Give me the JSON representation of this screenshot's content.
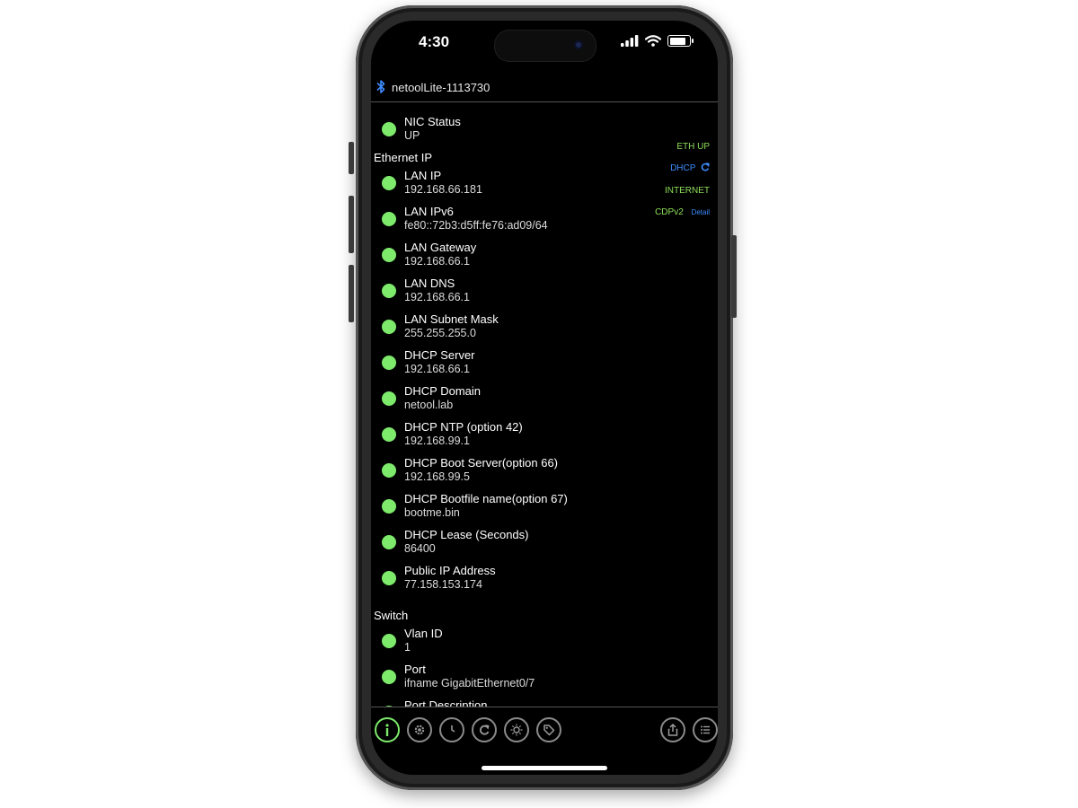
{
  "status_bar": {
    "time": "4:30"
  },
  "header": {
    "device_name": "netoolLite-1113730"
  },
  "indicators": {
    "eth_up": "ETH UP",
    "dhcp": "DHCP",
    "internet": "INTERNET",
    "cdp": "CDPv2",
    "detail": "Detail"
  },
  "nic": {
    "label": "NIC Status",
    "value": "UP"
  },
  "sections": {
    "ethernet_ip": "Ethernet IP",
    "switch": "Switch"
  },
  "ethernet_items": [
    {
      "label": "LAN IP",
      "value": "192.168.66.181"
    },
    {
      "label": "LAN IPv6",
      "value": "fe80::72b3:d5ff:fe76:ad09/64"
    },
    {
      "label": "LAN Gateway",
      "value": "192.168.66.1"
    },
    {
      "label": "LAN DNS",
      "value": "192.168.66.1"
    },
    {
      "label": "LAN Subnet Mask",
      "value": "255.255.255.0"
    },
    {
      "label": "DHCP Server",
      "value": "192.168.66.1"
    },
    {
      "label": "DHCP Domain",
      "value": "netool.lab"
    },
    {
      "label": "DHCP NTP (option 42)",
      "value": "192.168.99.1"
    },
    {
      "label": "DHCP Boot Server(option 66)",
      "value": "192.168.99.5"
    },
    {
      "label": "DHCP Bootfile name(option 67)",
      "value": "bootme.bin"
    },
    {
      "label": "DHCP Lease (Seconds)",
      "value": "86400"
    },
    {
      "label": "Public IP Address",
      "value": " 77.158.153.174"
    }
  ],
  "switch_items": [
    {
      "label": "Vlan ID",
      "value": "1"
    },
    {
      "label": "Port",
      "value": "ifname GigabitEthernet0/7"
    },
    {
      "label": "Port Description",
      "value": ""
    }
  ],
  "colors": {
    "status_green": "#7dea6b",
    "accent_blue": "#3c8cff",
    "indicator_green": "#8fe05a"
  },
  "battery_level": 0.85
}
